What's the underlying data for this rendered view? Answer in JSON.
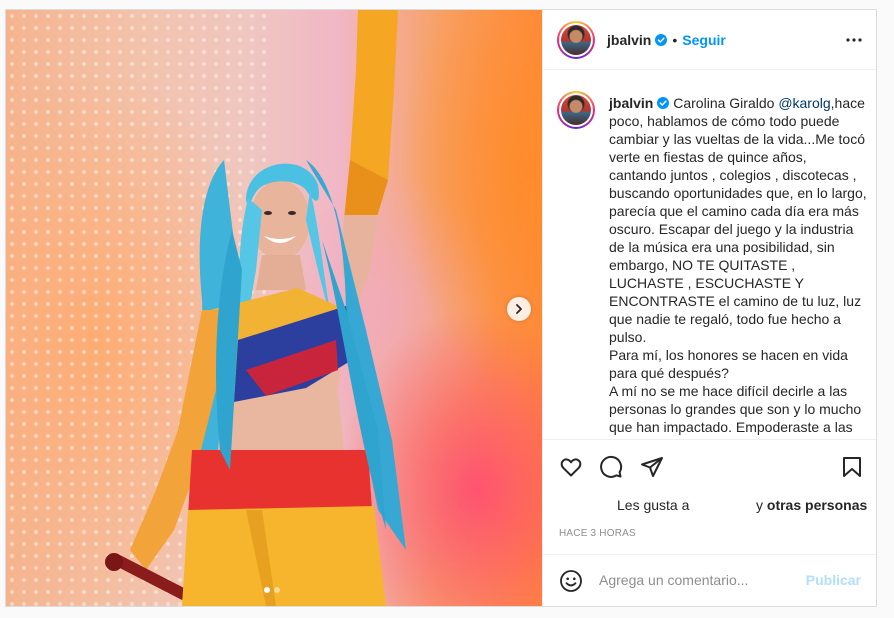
{
  "post": {
    "author": "jbalvin",
    "follow_label": "Seguir",
    "separator": "•",
    "caption": {
      "mention": "@karolg",
      "before_mention": "Carolina Giraldo ",
      "after_mention": ",hace poco, hablamos de cómo todo puede cambiar y las vueltas de la vida...Me tocó verte en fiestas de quince años, cantando juntos , colegios , discotecas , buscando oportunidades que, en lo largo, parecía que el camino cada día era más oscuro. Escapar del juego y la industria de la música era una posibilidad, sin embargo, NO TE QUITASTE , LUCHASTE , ESCUCHASTE Y ENCONTRASTE el camino de tu luz, luz que nadie te regaló, todo fue hecho a pulso.\nPara mí, los honores se hacen en vida para qué después?\nA mí no se me hace difícil decirle a las personas lo grandes que son y lo mucho que han impactado. Empoderaste a las"
    },
    "likes_prefix": "Les gusta a",
    "likes_connector": "y",
    "likes_others": "otras personas",
    "timestamp": "HACE 3 HORAS",
    "comment_placeholder": "Agrega un comentario...",
    "publish_label": "Publicar",
    "carousel": {
      "count": 2,
      "active_index": 0
    }
  },
  "icons": {
    "verified": "verified-badge-icon",
    "more": "more-options-icon",
    "like": "heart-icon",
    "comment": "comment-icon",
    "share": "paper-plane-icon",
    "save": "bookmark-icon",
    "emoji": "emoji-icon",
    "next": "chevron-right-icon"
  },
  "colors": {
    "accent": "#0095f6",
    "publish_disabled": "#b2dffc",
    "mention": "#00376b",
    "muted": "#8e8e8e"
  }
}
